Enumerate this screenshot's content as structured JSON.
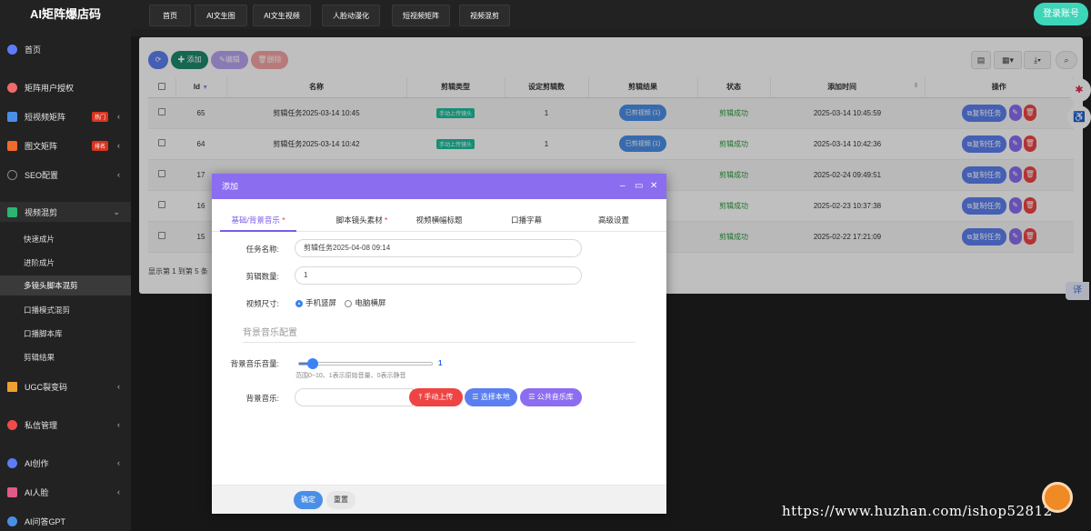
{
  "app": {
    "title": "AI矩阵爆店码",
    "login": "登录账号"
  },
  "sidebar": {
    "items": [
      {
        "label": "首页",
        "icon": "home-icon",
        "color": "#5c7cfa"
      },
      {
        "label": "矩阵用户授权",
        "icon": "user-auth-icon",
        "color": "#f06a6a"
      },
      {
        "label": "短视频矩阵",
        "icon": "video-matrix-icon",
        "color": "#4a8fe7",
        "badge": "热门"
      },
      {
        "label": "图文矩阵",
        "icon": "image-text-icon",
        "color": "#f06a2a",
        "badge": "排名"
      },
      {
        "label": "SEO配置",
        "icon": "seo-icon",
        "color": "#888888"
      },
      {
        "label": "视频混剪",
        "icon": "video-mix-icon",
        "color": "#2bb673"
      },
      {
        "label": "UGC裂变码",
        "icon": "qr-icon",
        "color": "#f0a030"
      },
      {
        "label": "私信管理",
        "icon": "message-icon",
        "color": "#f04a4a"
      },
      {
        "label": "AI创作",
        "icon": "ai-create-icon",
        "color": "#5c7cfa"
      },
      {
        "label": "AI人脸",
        "icon": "ai-face-icon",
        "color": "#e05a8a"
      },
      {
        "label": "AI问答GPT",
        "icon": "gpt-icon",
        "color": "#4a8fe7"
      }
    ],
    "subitems": [
      "快速成片",
      "进阶成片",
      "多镜头脚本混剪",
      "口播模式混剪",
      "口播脚本库",
      "剪辑结果"
    ]
  },
  "top_tabs": [
    "首页",
    "AI文生图",
    "AI文生视频",
    "人脸动漫化",
    "短视频矩阵",
    "视频混剪"
  ],
  "toolbar": {
    "add": "添加",
    "edit": "编辑",
    "delete": "删除"
  },
  "table": {
    "headers": [
      "Id",
      "名称",
      "剪辑类型",
      "设定剪辑数",
      "剪辑结果",
      "状态",
      "添加时间",
      "操作"
    ],
    "rows": [
      {
        "id": "65",
        "name": "剪辑任务2025-03-14 10:45",
        "type": "手动上传镜头",
        "count": "1",
        "result": "已剪视频 (1)",
        "status": "剪辑成功",
        "time": "2025-03-14 10:45:59"
      },
      {
        "id": "64",
        "name": "剪辑任务2025-03-14 10:42",
        "type": "手动上传镜头",
        "count": "1",
        "result": "已剪视频 (1)",
        "status": "剪辑成功",
        "time": "2025-03-14 10:42:36"
      },
      {
        "id": "17",
        "name": "",
        "type": "",
        "count": "",
        "result": "",
        "status": "剪辑成功",
        "time": "2025-02-24 09:49:51"
      },
      {
        "id": "16",
        "name": "",
        "type": "",
        "count": "",
        "result": "",
        "status": "剪辑成功",
        "time": "2025-02-23 10:37:38"
      },
      {
        "id": "15",
        "name": "",
        "type": "",
        "count": "",
        "result": "",
        "status": "剪辑成功",
        "time": "2025-02-22 17:21:09"
      }
    ],
    "copy_label": "复制任务",
    "footer": "显示第 1 到第 5 条"
  },
  "modal": {
    "title": "添加",
    "tabs": [
      "基础/背景音乐",
      "脚本镜头素材",
      "视频横幅标题",
      "口播字幕",
      "高级设置"
    ],
    "task_name_label": "任务名称:",
    "task_name_value": "剪辑任务2025-04-08 09:14",
    "count_label": "剪辑数量:",
    "count_value": "1",
    "size_label": "视频尺寸:",
    "size_options": [
      "手机竖屏",
      "电脑横屏"
    ],
    "section_title": "背景音乐配置",
    "volume_label": "背景音乐音量:",
    "volume_value": "1",
    "volume_level": 0.1,
    "volume_hint": "范围0~10、1表示原始音量、0表示静音",
    "music_label": "背景音乐:",
    "upload": "手动上传",
    "local": "选择本地",
    "library": "公共音乐库",
    "confirm": "确定",
    "reset": "重置"
  },
  "watermark": "https://www.huzhan.com/ishop52812",
  "float": {
    "translate": "译"
  }
}
